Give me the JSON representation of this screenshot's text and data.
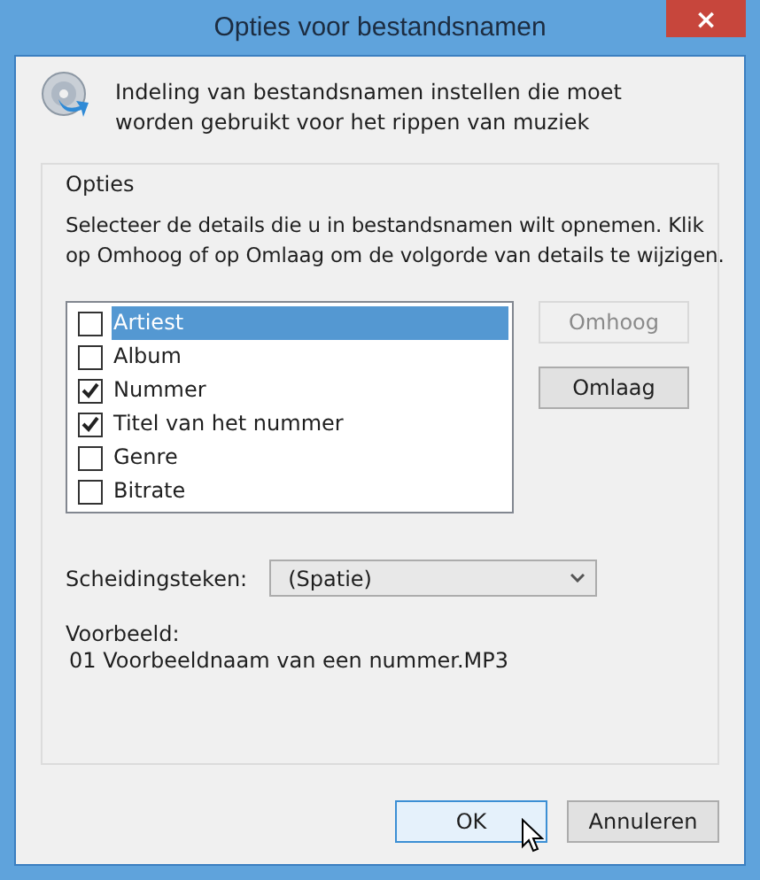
{
  "window": {
    "title": "Opties voor bestandsnamen",
    "close": "×"
  },
  "description": "Indeling van bestandsnamen instellen die moet worden gebruikt voor het rippen van muziek",
  "group": {
    "title": "Opties",
    "instructions": "Selecteer de details die u in bestandsnamen wilt opnemen. Klik op Omhoog of op Omlaag om de volgorde van details te wijzigen.",
    "details": [
      {
        "label": "Artiest",
        "checked": false,
        "selected": true
      },
      {
        "label": "Album",
        "checked": false,
        "selected": false
      },
      {
        "label": "Nummer",
        "checked": true,
        "selected": false
      },
      {
        "label": "Titel van het nummer",
        "checked": true,
        "selected": false
      },
      {
        "label": "Genre",
        "checked": false,
        "selected": false
      },
      {
        "label": "Bitrate",
        "checked": false,
        "selected": false
      }
    ],
    "order_buttons": [
      {
        "label": "Omhoog",
        "disabled": true
      },
      {
        "label": "Omlaag",
        "disabled": false
      }
    ],
    "separator": {
      "label": "Scheidingsteken:",
      "value": "(Spatie)"
    },
    "preview": {
      "label": "Voorbeeld:",
      "value": "01 Voorbeeldnaam van een nummer.MP3"
    }
  },
  "buttons": [
    {
      "label": "OK",
      "default": true
    },
    {
      "label": "Annuleren",
      "default": false
    }
  ]
}
